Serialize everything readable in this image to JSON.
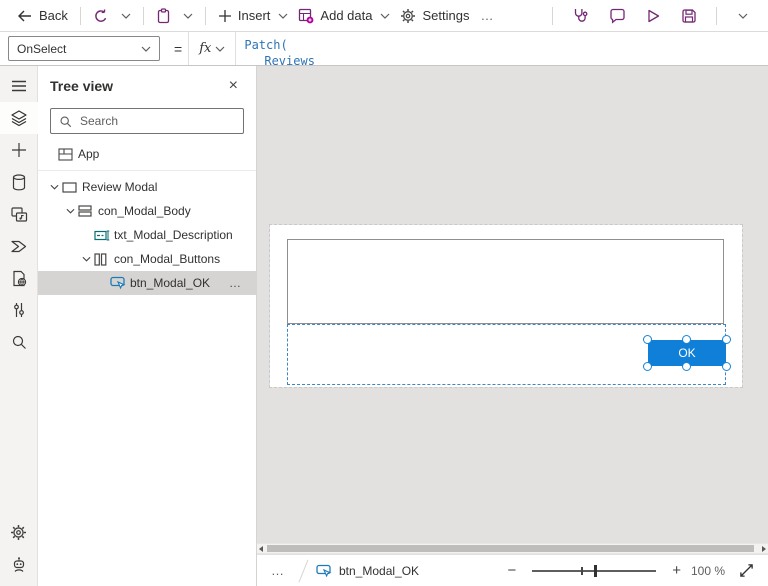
{
  "toolbar": {
    "back_label": "Back",
    "insert_label": "Insert",
    "add_data_label": "Add data",
    "settings_label": "Settings",
    "overflow": "…"
  },
  "formula_bar": {
    "property": "OnSelect",
    "equals_sign": "=",
    "fx_label": "fx",
    "lines": [
      "Patch(",
      "Reviews"
    ]
  },
  "tree_panel": {
    "title": "Tree view",
    "close_glyph": "×",
    "search_placeholder": "Search",
    "items": [
      {
        "label": "App",
        "type": "app"
      },
      {
        "label": "Review Modal",
        "type": "screen",
        "expanded": true
      },
      {
        "label": "con_Modal_Body",
        "type": "container-rows",
        "expanded": true
      },
      {
        "label": "txt_Modal_Description",
        "type": "text-input"
      },
      {
        "label": "con_Modal_Buttons",
        "type": "container-columns",
        "expanded": true
      },
      {
        "label": "btn_Modal_OK",
        "type": "button",
        "selected": true
      }
    ],
    "row_overflow": "…"
  },
  "canvas": {
    "ok_button_label": "OK"
  },
  "status_bar": {
    "overflow": "…",
    "selected_control": "btn_Modal_OK",
    "zoom_out": "−",
    "zoom_in": "+",
    "zoom_level": "100 %"
  },
  "colors": {
    "brand_purple": "#742774",
    "accent_blue": "#0f7fd7",
    "selection_dash_blue": "#3f86c6",
    "formula_blue": "#2e74b5",
    "canvas_gray": "#e2e1e0"
  },
  "icons": {
    "toolbar": [
      "back-arrow",
      "undo",
      "clipboard",
      "chevron-down",
      "plus",
      "add-data-table",
      "gear",
      "app-checker-stethoscope",
      "comment",
      "play",
      "save"
    ],
    "rail": [
      "hamburger",
      "tree-view-layers",
      "plus",
      "data-cylinder",
      "media-screens",
      "power-automate",
      "advanced-tools-page-globe",
      "variables-sliders",
      "search",
      "gear",
      "virtual-agent-bot"
    ]
  }
}
